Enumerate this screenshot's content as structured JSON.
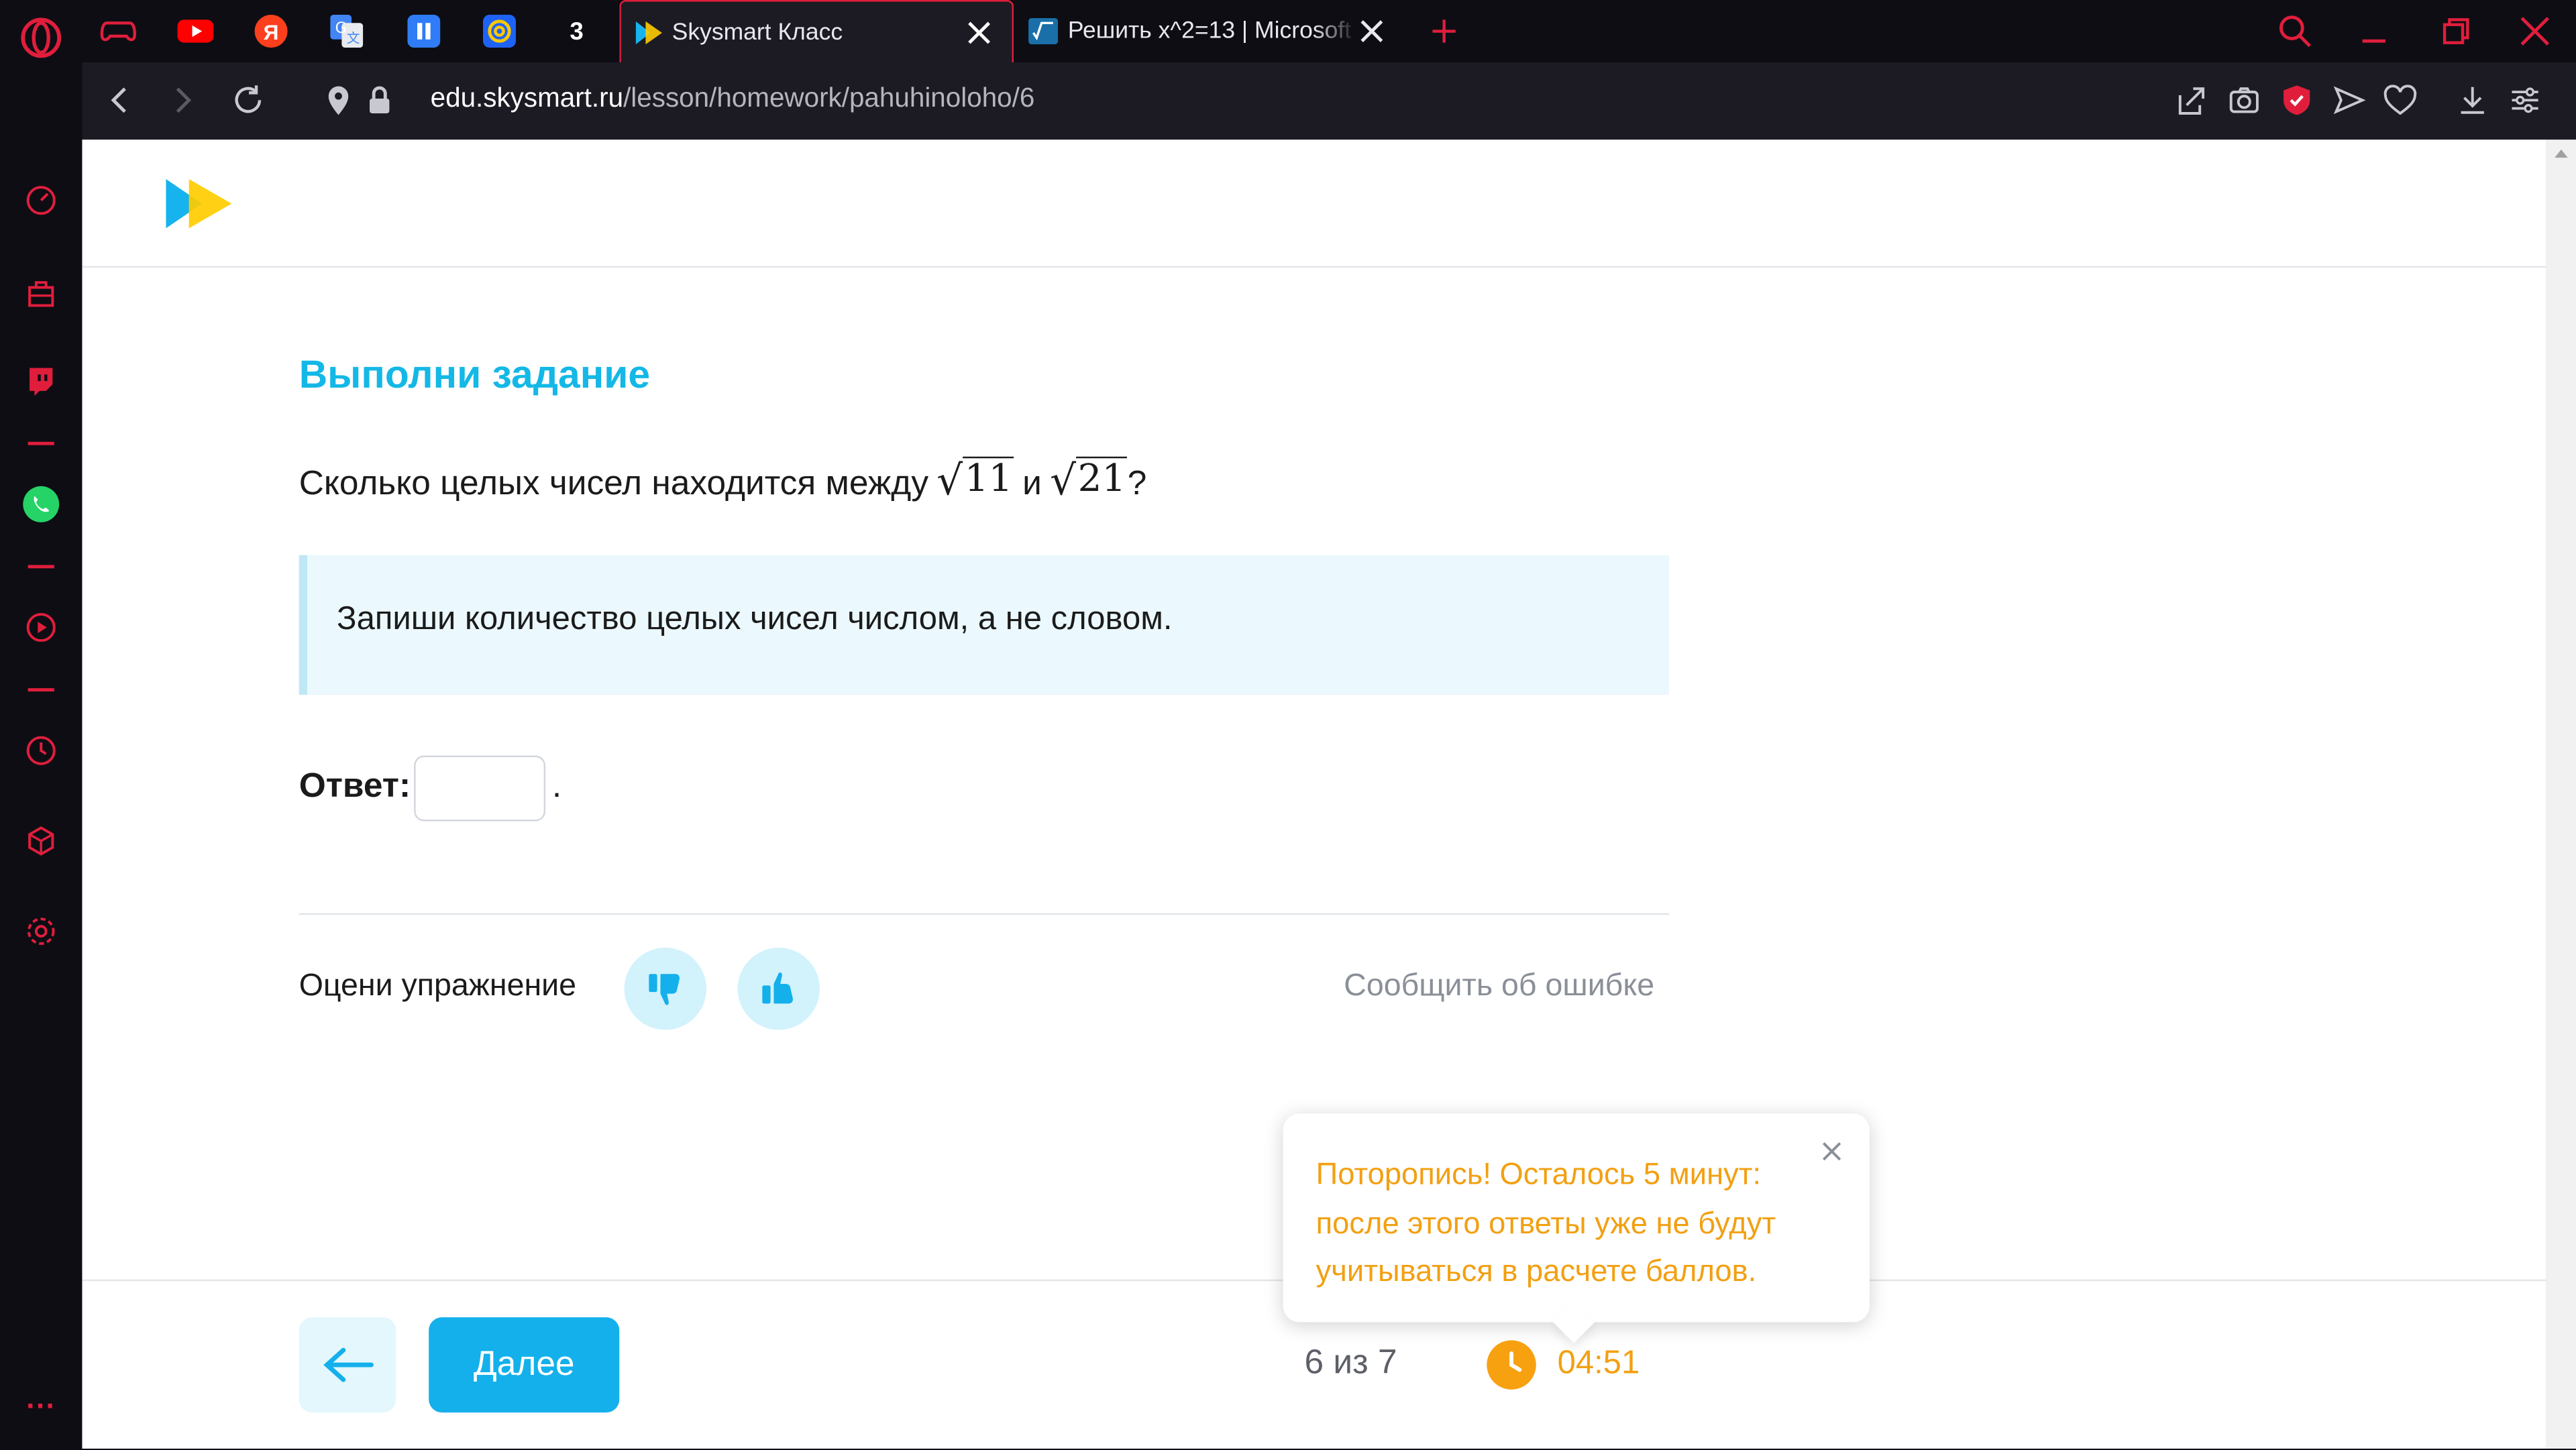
{
  "browser": {
    "pinned_tabs": [
      {
        "icon": "gamepad-icon"
      },
      {
        "icon": "youtube-icon"
      },
      {
        "icon": "yandex-icon",
        "label": "Я"
      },
      {
        "icon": "google-translate-icon"
      },
      {
        "icon": "pause-app-icon"
      },
      {
        "icon": "mail-at-icon"
      },
      {
        "icon": "number-app-icon",
        "label": "3"
      }
    ],
    "tabs": [
      {
        "title": "Skysmart Класс",
        "active": true
      },
      {
        "title": "Решить x^2=13 | Microsoft",
        "active": false
      }
    ],
    "url_host": "edu.skysmart.ru",
    "url_path": "/lesson/homework/pahuhinoloho/6"
  },
  "sidebar": {
    "items": [
      "speed-dial-icon",
      "shopping-bag-icon",
      "twitch-icon",
      "whatsapp-icon",
      "player-icon",
      "history-icon",
      "extensions-icon",
      "settings-icon"
    ],
    "more_label": "···"
  },
  "colors": {
    "accent": "#14b0eb",
    "warning": "#f2a012",
    "opera_red": "#e01e3c"
  },
  "task": {
    "title": "Выполни задание",
    "question_prefix": "Сколько целых чисел находится между",
    "sqrt_a": "11",
    "connector": "и",
    "sqrt_b": "21",
    "question_suffix": "?",
    "hint": "Запиши количество целых чисел числом, а не словом.",
    "answer_label": "Ответ:",
    "answer_value": "",
    "answer_suffix": "."
  },
  "rating": {
    "label": "Оцени упражнение",
    "report": "Сообщить об ошибке"
  },
  "toast": {
    "text": "Поторопись! Осталось 5 минут: после этого ответы уже не будут учитываться в расчете баллов."
  },
  "footer": {
    "next_label": "Далее",
    "progress": "6 из 7",
    "timer": "04:51"
  }
}
